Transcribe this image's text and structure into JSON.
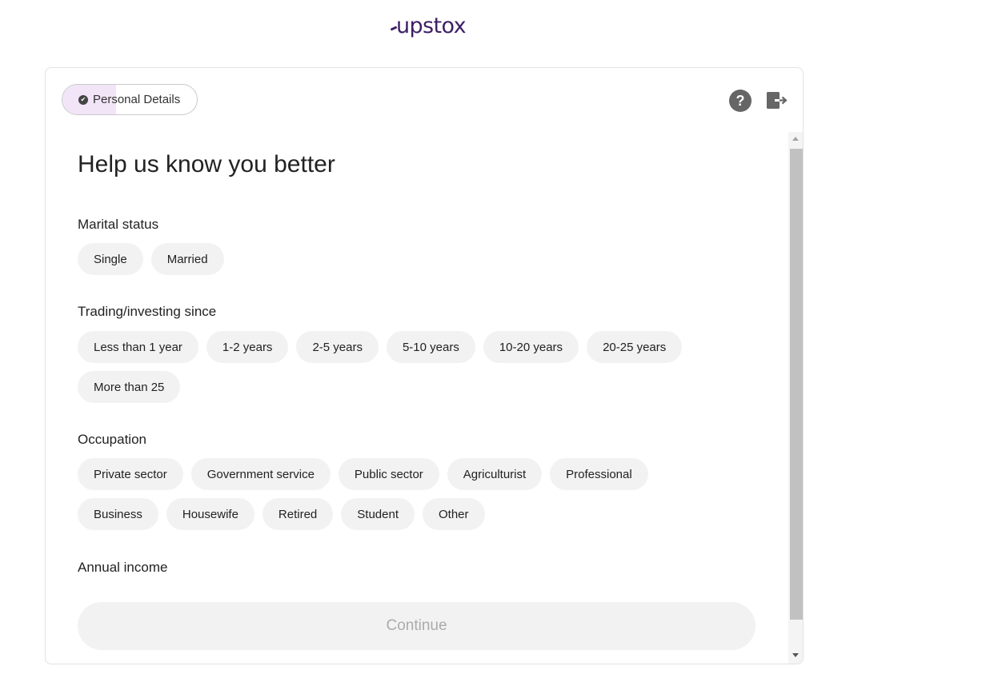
{
  "brand": {
    "logo_text": "upstox",
    "color": "#3e1f66"
  },
  "header": {
    "step_label": "Personal Details",
    "step_progress": 0.4,
    "help_icon": "question-circle-icon",
    "help_symbol": "?",
    "logout_icon": "logout-icon"
  },
  "form": {
    "title": "Help us know you better",
    "marital_status": {
      "label": "Marital status",
      "options": [
        "Single",
        "Married"
      ]
    },
    "trading_since": {
      "label": "Trading/investing since",
      "options_row1": [
        "Less than 1 year",
        "1-2 years",
        "2-5 years",
        "5-10 years",
        "10-20 years",
        "20-25 years"
      ],
      "options_row2": [
        "More than 25"
      ]
    },
    "occupation": {
      "label": "Occupation",
      "options_row1": [
        "Private sector",
        "Government service",
        "Public sector",
        "Agriculturist",
        "Professional"
      ],
      "options_row2": [
        "Business",
        "Housewife",
        "Retired",
        "Student",
        "Other"
      ]
    },
    "annual_income": {
      "label": "Annual income"
    },
    "continue_label": "Continue"
  }
}
